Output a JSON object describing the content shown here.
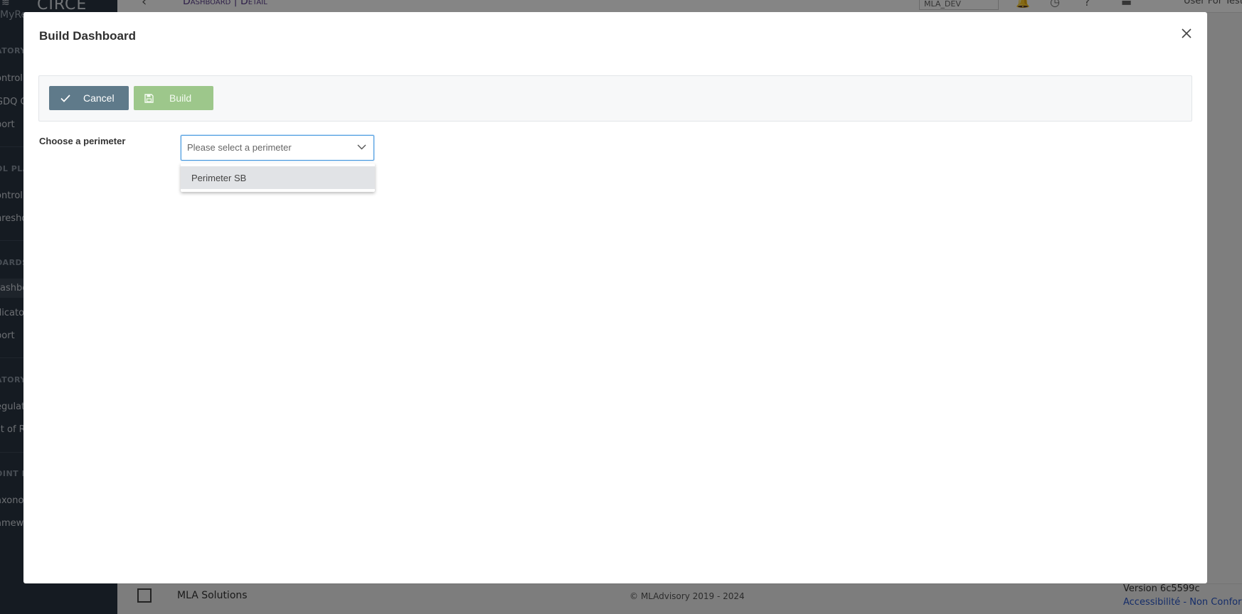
{
  "background_app": {
    "brand_name": "CIRCE",
    "brand_sub": "MyReg",
    "breadcrumb": "Dashboard | Detail",
    "env_select": "MLA_DEV",
    "user_name": "User For Test",
    "sidebar": {
      "sections": [
        {
          "label": "ATORY",
          "items": [
            "ontrol",
            "GDQ C",
            "port"
          ]
        },
        {
          "label": "OL PLA",
          "items": [
            "ontrol",
            "hresho"
          ]
        },
        {
          "label": "OARDS",
          "items": [
            "ashbo",
            "dicato",
            "port"
          ]
        },
        {
          "label": "ATORY",
          "items": [
            "egulat",
            "st of R"
          ]
        },
        {
          "label": "OINT I",
          "items": [
            "axono",
            "amew"
          ]
        }
      ]
    },
    "footer": {
      "brand": "MLA Solutions",
      "copyright": "© MLAdvisory 2019 - 2024",
      "version": "Version 6c5599c",
      "accessibility": "Accessibilité - Non Conform"
    }
  },
  "modal": {
    "title": "Build Dashboard",
    "close_icon": "close-icon",
    "toolbar": {
      "cancel_label": "Cancel",
      "cancel_icon": "check-icon",
      "build_label": "Build",
      "build_icon": "save-icon"
    },
    "perimeter": {
      "label": "Choose a perimeter",
      "placeholder": "Please select a perimeter",
      "options": [
        "Perimeter SB"
      ]
    }
  },
  "colors": {
    "cancel_button": "#5f7a8a",
    "build_button": "#9dc78b",
    "select_focus": "#4a9be0",
    "sidebar": "#2a3442"
  }
}
